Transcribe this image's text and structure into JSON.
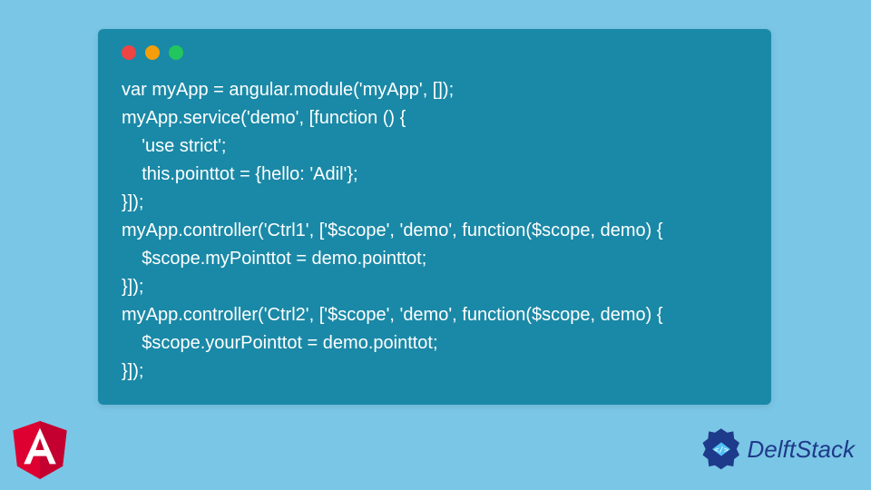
{
  "code": {
    "lines": [
      "var myApp = angular.module('myApp', []);",
      "myApp.service('demo', [function () {",
      "    'use strict';",
      "    this.pointtot = {hello: 'Adil'};",
      "}]);",
      "myApp.controller('Ctrl1', ['$scope', 'demo', function($scope, demo) {",
      "    $scope.myPointtot = demo.pointtot;",
      "}]);",
      "myApp.controller('Ctrl2', ['$scope', 'demo', function($scope, demo) {",
      "    $scope.yourPointtot = demo.pointtot;",
      "}]);"
    ]
  },
  "branding": {
    "text": "DelftStack"
  }
}
